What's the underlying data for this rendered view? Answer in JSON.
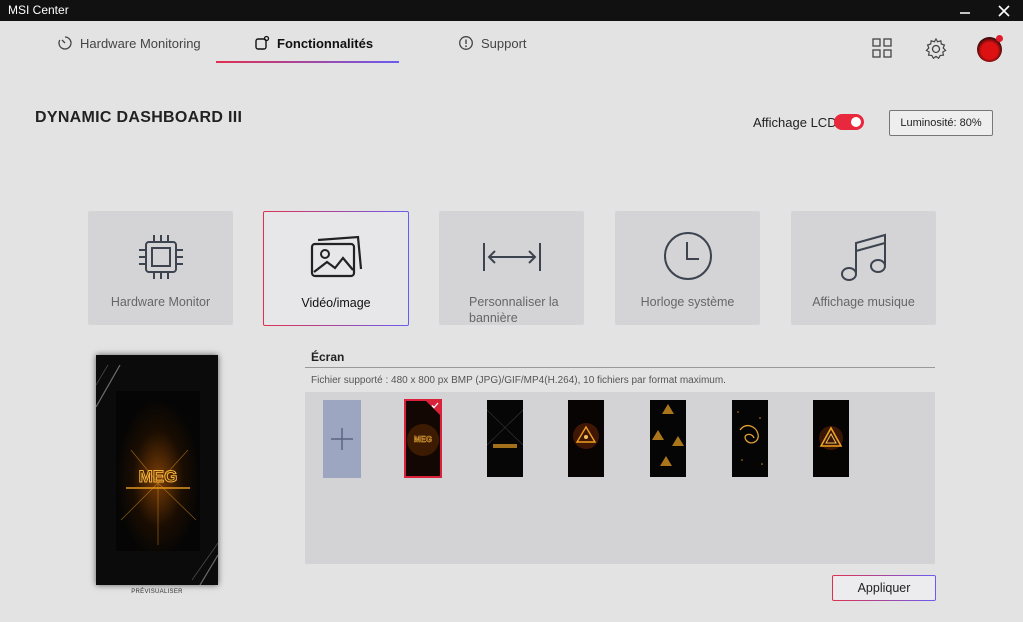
{
  "app": {
    "title": "MSI Center"
  },
  "window": {
    "minimize": "—",
    "close": "✕"
  },
  "tabs": [
    {
      "label": "Hardware Monitoring",
      "icon": "gauge-icon"
    },
    {
      "label": "Fonctionnalités",
      "icon": "feature-icon",
      "active": true
    },
    {
      "label": "Support",
      "icon": "alert-icon"
    }
  ],
  "header_icons": [
    "grid-icon",
    "gear-icon",
    "avatar"
  ],
  "page": {
    "title": "DYNAMIC DASHBOARD III"
  },
  "lcd": {
    "label": "Affichage LCD",
    "enabled": true
  },
  "brightness": {
    "label": "Luminosité: 80%"
  },
  "modes": [
    {
      "label": "Hardware Monitor",
      "icon": "chip-icon"
    },
    {
      "label": "Vidéo/image",
      "icon": "image-icon",
      "selected": true
    },
    {
      "label": "Personnaliser la bannière",
      "icon": "banner-arrows-icon"
    },
    {
      "label": "Horloge système",
      "icon": "clock-icon"
    },
    {
      "label": "Affichage musique",
      "icon": "music-icon"
    }
  ],
  "preview": {
    "label": "PRÉVISUALISER"
  },
  "screen": {
    "title": "Écran",
    "info": "Fichier supporté : 480 x 800 px BMP (JPG)/GIF/MP4(H.264), 10 fichiers par format maximum.",
    "thumbnails_count": 6,
    "selected_index": 0
  },
  "apply": {
    "label": "Appliquer"
  },
  "colors": {
    "accent_red": "#e8283c",
    "accent_violet": "#6a5cf0",
    "gold": "#f0a020"
  }
}
